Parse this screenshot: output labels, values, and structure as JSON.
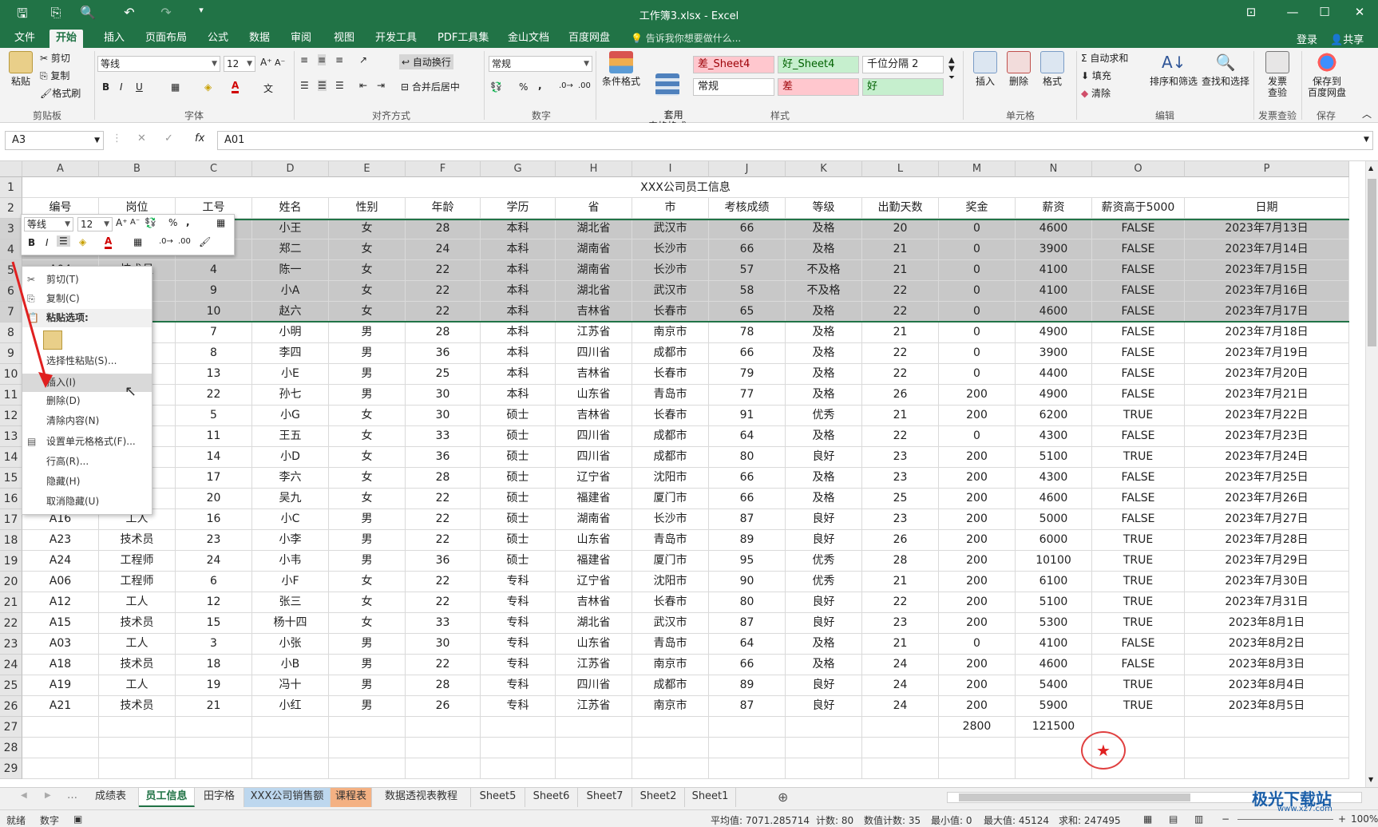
{
  "window": {
    "title": "工作簿3.xlsx - Excel",
    "buttons": [
      "⊡",
      "—",
      "☐",
      "✕"
    ]
  },
  "quick_access": [
    "🖫",
    "⎘",
    "🔍",
    "↶",
    "↷",
    "▾"
  ],
  "ribbon_tabs": [
    "文件",
    "开始",
    "插入",
    "页面布局",
    "公式",
    "数据",
    "审阅",
    "视图",
    "开发工具",
    "PDF工具集",
    "金山文档",
    "百度网盘"
  ],
  "tell_me": "告诉我你想要做什么...",
  "account": {
    "login": "登录",
    "share": "共享"
  },
  "ribbon": {
    "clipboard": {
      "paste": "粘贴",
      "cut": "剪切",
      "copy": "复制",
      "painter": "格式刷",
      "label": "剪贴板"
    },
    "font": {
      "name": "等线",
      "size": "12",
      "label": "字体",
      "bold": "B",
      "italic": "I",
      "underline": "U"
    },
    "align": {
      "wrap": "自动换行",
      "merge": "合并后居中",
      "label": "对齐方式"
    },
    "number": {
      "format": "常规",
      "pct": "%",
      "comma": ",",
      "label": "数字"
    },
    "styles": {
      "cond": "条件格式",
      "table": "套用\n表格格式",
      "cells": [
        "差_Sheet4",
        "好_Sheet4",
        "千位分隔 2",
        "常规",
        "差",
        "好"
      ],
      "label": "样式"
    },
    "cellsgrp": {
      "insert": "插入",
      "delete": "删除",
      "format": "格式",
      "label": "单元格"
    },
    "editing": {
      "autosum": "自动求和",
      "fill": "填充",
      "clear": "清除",
      "sort": "排序和筛选",
      "find": "查找和选择",
      "label": "编辑"
    },
    "invoice": {
      "btn": "发票\n查验",
      "label": "发票查验"
    },
    "save": {
      "btn": "保存到\n百度网盘",
      "label": "保存"
    }
  },
  "namebox": "A3",
  "formula": "A01",
  "columns": [
    "A",
    "B",
    "C",
    "D",
    "E",
    "F",
    "G",
    "H",
    "I",
    "J",
    "K",
    "L",
    "M",
    "N",
    "O",
    "P"
  ],
  "title_row": "XXX公司员工信息",
  "headers": [
    "编号",
    "岗位",
    "工号",
    "姓名",
    "性别",
    "年龄",
    "学历",
    "省",
    "市",
    "考核成绩",
    "等级",
    "出勤天数",
    "奖金",
    "薪资",
    "薪资高于5000",
    "日期"
  ],
  "rows": [
    [
      "A",
      "B",
      "3",
      "小王",
      "女",
      "28",
      "本科",
      "湖北省",
      "武汉市",
      "66",
      "及格",
      "20",
      "0",
      "4600",
      "FALSE",
      "2023年7月13日"
    ],
    [
      "A",
      "B",
      "2",
      "郑二",
      "女",
      "24",
      "本科",
      "湖南省",
      "长沙市",
      "66",
      "及格",
      "21",
      "0",
      "3900",
      "FALSE",
      "2023年7月14日"
    ],
    [
      "A04",
      "技术员",
      "4",
      "陈一",
      "女",
      "22",
      "本科",
      "湖南省",
      "长沙市",
      "57",
      "不及格",
      "21",
      "0",
      "4100",
      "FALSE",
      "2023年7月15日"
    ],
    [
      "",
      "",
      "9",
      "小A",
      "女",
      "22",
      "本科",
      "湖北省",
      "武汉市",
      "58",
      "不及格",
      "22",
      "0",
      "4100",
      "FALSE",
      "2023年7月16日"
    ],
    [
      "",
      "",
      "10",
      "赵六",
      "女",
      "22",
      "本科",
      "吉林省",
      "长春市",
      "65",
      "及格",
      "22",
      "0",
      "4600",
      "FALSE",
      "2023年7月17日"
    ],
    [
      "",
      "",
      "7",
      "小明",
      "男",
      "28",
      "本科",
      "江苏省",
      "南京市",
      "78",
      "及格",
      "21",
      "0",
      "4900",
      "FALSE",
      "2023年7月18日"
    ],
    [
      "",
      "",
      "8",
      "李四",
      "男",
      "36",
      "本科",
      "四川省",
      "成都市",
      "66",
      "及格",
      "22",
      "0",
      "3900",
      "FALSE",
      "2023年7月19日"
    ],
    [
      "",
      "",
      "13",
      "小E",
      "男",
      "25",
      "本科",
      "吉林省",
      "长春市",
      "79",
      "及格",
      "22",
      "0",
      "4400",
      "FALSE",
      "2023年7月20日"
    ],
    [
      "",
      "",
      "22",
      "孙七",
      "男",
      "30",
      "本科",
      "山东省",
      "青岛市",
      "77",
      "及格",
      "26",
      "200",
      "4900",
      "FALSE",
      "2023年7月21日"
    ],
    [
      "",
      "师",
      "5",
      "小G",
      "女",
      "30",
      "硕士",
      "吉林省",
      "长春市",
      "91",
      "优秀",
      "21",
      "200",
      "6200",
      "TRUE",
      "2023年7月22日"
    ],
    [
      "",
      "员",
      "11",
      "王五",
      "女",
      "33",
      "硕士",
      "四川省",
      "成都市",
      "64",
      "及格",
      "22",
      "0",
      "4300",
      "FALSE",
      "2023年7月23日"
    ],
    [
      "",
      "员",
      "14",
      "小D",
      "女",
      "36",
      "硕士",
      "四川省",
      "成都市",
      "80",
      "良好",
      "23",
      "200",
      "5100",
      "TRUE",
      "2023年7月24日"
    ],
    [
      "",
      "员",
      "17",
      "李六",
      "女",
      "28",
      "硕士",
      "辽宁省",
      "沈阳市",
      "66",
      "及格",
      "23",
      "200",
      "4300",
      "FALSE",
      "2023年7月25日"
    ],
    [
      "",
      "员",
      "20",
      "吴九",
      "女",
      "22",
      "硕士",
      "福建省",
      "厦门市",
      "66",
      "及格",
      "25",
      "200",
      "4600",
      "FALSE",
      "2023年7月26日"
    ],
    [
      "A16",
      "工人",
      "16",
      "小C",
      "男",
      "22",
      "硕士",
      "湖南省",
      "长沙市",
      "87",
      "良好",
      "23",
      "200",
      "5000",
      "FALSE",
      "2023年7月27日"
    ],
    [
      "A23",
      "技术员",
      "23",
      "小李",
      "男",
      "22",
      "硕士",
      "山东省",
      "青岛市",
      "89",
      "良好",
      "26",
      "200",
      "6000",
      "TRUE",
      "2023年7月28日"
    ],
    [
      "A24",
      "工程师",
      "24",
      "小韦",
      "男",
      "36",
      "硕士",
      "福建省",
      "厦门市",
      "95",
      "优秀",
      "28",
      "200",
      "10100",
      "TRUE",
      "2023年7月29日"
    ],
    [
      "A06",
      "工程师",
      "6",
      "小F",
      "女",
      "22",
      "专科",
      "辽宁省",
      "沈阳市",
      "90",
      "优秀",
      "21",
      "200",
      "6100",
      "TRUE",
      "2023年7月30日"
    ],
    [
      "A12",
      "工人",
      "12",
      "张三",
      "女",
      "22",
      "专科",
      "吉林省",
      "长春市",
      "80",
      "良好",
      "22",
      "200",
      "5100",
      "TRUE",
      "2023年7月31日"
    ],
    [
      "A15",
      "技术员",
      "15",
      "杨十四",
      "女",
      "33",
      "专科",
      "湖北省",
      "武汉市",
      "87",
      "良好",
      "23",
      "200",
      "5300",
      "TRUE",
      "2023年8月1日"
    ],
    [
      "A03",
      "工人",
      "3",
      "小张",
      "男",
      "30",
      "专科",
      "山东省",
      "青岛市",
      "64",
      "及格",
      "21",
      "0",
      "4100",
      "FALSE",
      "2023年8月2日"
    ],
    [
      "A18",
      "技术员",
      "18",
      "小B",
      "男",
      "22",
      "专科",
      "江苏省",
      "南京市",
      "66",
      "及格",
      "24",
      "200",
      "4600",
      "FALSE",
      "2023年8月3日"
    ],
    [
      "A19",
      "工人",
      "19",
      "冯十",
      "男",
      "28",
      "专科",
      "四川省",
      "成都市",
      "89",
      "良好",
      "24",
      "200",
      "5400",
      "TRUE",
      "2023年8月4日"
    ],
    [
      "A21",
      "技术员",
      "21",
      "小红",
      "男",
      "26",
      "专科",
      "江苏省",
      "南京市",
      "87",
      "良好",
      "24",
      "200",
      "5900",
      "TRUE",
      "2023年8月5日"
    ]
  ],
  "totals": {
    "bonus": "2800",
    "salary": "121500"
  },
  "mini_toolbar": {
    "font": "等线",
    "size": "12"
  },
  "context_menu": [
    "剪切(T)",
    "复制(C)",
    "粘贴选项:",
    "",
    "选择性粘贴(S)...",
    "插入(I)",
    "删除(D)",
    "清除内容(N)",
    "设置单元格格式(F)...",
    "行高(R)...",
    "隐藏(H)",
    "取消隐藏(U)"
  ],
  "sheet_tabs": [
    "成绩表",
    "员工信息",
    "田字格",
    "XXX公司销售额",
    "课程表",
    "数据透视表教程",
    "Sheet5",
    "Sheet6",
    "Sheet7",
    "Sheet2",
    "Sheet1"
  ],
  "status": {
    "mode": "就绪",
    "numlock": "数字",
    "avg": "平均值: 7071.285714",
    "count": "计数: 80",
    "numcount": "数值计数: 35",
    "min": "最小值: 0",
    "max": "最大值: 45124",
    "sum": "求和: 247495",
    "zoom": "100%"
  },
  "watermark": "极光下载站",
  "watermark_url": "www.xz7.com",
  "accent": "#217346"
}
